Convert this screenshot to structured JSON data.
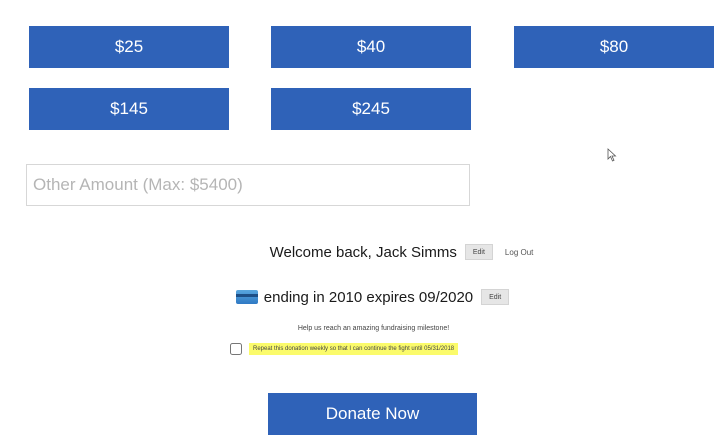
{
  "amounts": [
    {
      "label": "$25"
    },
    {
      "label": "$40"
    },
    {
      "label": "$80"
    },
    {
      "label": "$145"
    },
    {
      "label": "$245"
    }
  ],
  "other_amount": {
    "placeholder": "Other Amount (Max: $5400)",
    "value": ""
  },
  "account": {
    "welcome_text": "Welcome back, Jack Simms",
    "edit_label": "Edit",
    "logout_label": "Log Out"
  },
  "payment": {
    "card_icon": "credit-card-icon",
    "card_text": "ending in 2010 expires 09/2020",
    "edit_label": "Edit"
  },
  "milestone_text": "Help us reach an amazing fundraising milestone!",
  "repeat": {
    "checked": false,
    "label": "Repeat this donation weekly so that I can continue the fight until 05/31/2018"
  },
  "donate_label": "Donate Now",
  "colors": {
    "button": "#2f62b8",
    "highlight": "#fbfb6b"
  },
  "cursor_icon": "mouse-pointer-icon"
}
